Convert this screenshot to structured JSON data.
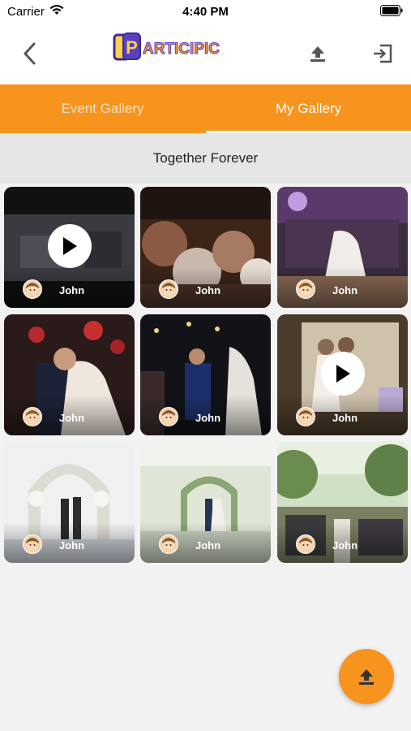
{
  "status_bar": {
    "carrier": "Carrier",
    "time": "4:40 PM"
  },
  "header": {
    "logo_text": "PARTICIPIC",
    "icons": {
      "back": "chevron-left-icon",
      "upload": "upload-icon",
      "logout": "logout-icon"
    }
  },
  "tabs": [
    {
      "label": "Event Gallery",
      "selected": false
    },
    {
      "label": "My Gallery",
      "selected": true
    }
  ],
  "album": {
    "title": "Together Forever"
  },
  "gallery": [
    {
      "author": "John",
      "is_video": true
    },
    {
      "author": "John",
      "is_video": false
    },
    {
      "author": "John",
      "is_video": false
    },
    {
      "author": "John",
      "is_video": false
    },
    {
      "author": "John",
      "is_video": false
    },
    {
      "author": "John",
      "is_video": true
    },
    {
      "author": "John",
      "is_video": false
    },
    {
      "author": "John",
      "is_video": false
    },
    {
      "author": "John",
      "is_video": false
    }
  ],
  "colors": {
    "accent": "#f7941d",
    "background": "#f2f2f2",
    "album_bar": "#e6e6e6"
  }
}
